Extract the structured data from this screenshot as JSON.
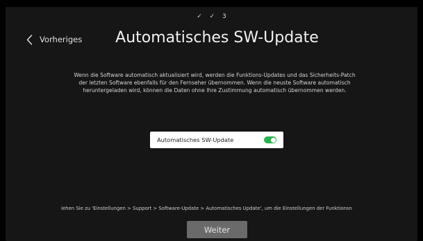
{
  "steps": {
    "step1": "✓",
    "step2": "✓",
    "step3": "3"
  },
  "nav": {
    "back_label": "Vorheriges"
  },
  "page": {
    "title": "Automatisches SW-Update",
    "description_lines": [
      "Wenn die Software automatisch aktualisiert wird, werden die Funktions-Updates und das Sicherheits-Patch",
      "der letzten Software ebenfalls für den Fernseher übernommen. Wenn die neuste Software automatisch",
      "heruntergeladen wird, können die Daten ohne Ihre Zustimmung automatisch übernommen werden."
    ]
  },
  "setting": {
    "label": "Automatisches SW-Update",
    "enabled": true
  },
  "hint": {
    "text": "iehen Sie zu 'Einstellungen > Support > Software-Update > Automatisches Update', um die Einstellungen der Funktionsn"
  },
  "footer": {
    "next_label": "Weiter"
  },
  "colors": {
    "toggle_on": "#2bb24c",
    "button_bg": "#6a6a6a",
    "panel_bg": "#161616"
  },
  "icons": {
    "back": "chevron-left-icon"
  }
}
